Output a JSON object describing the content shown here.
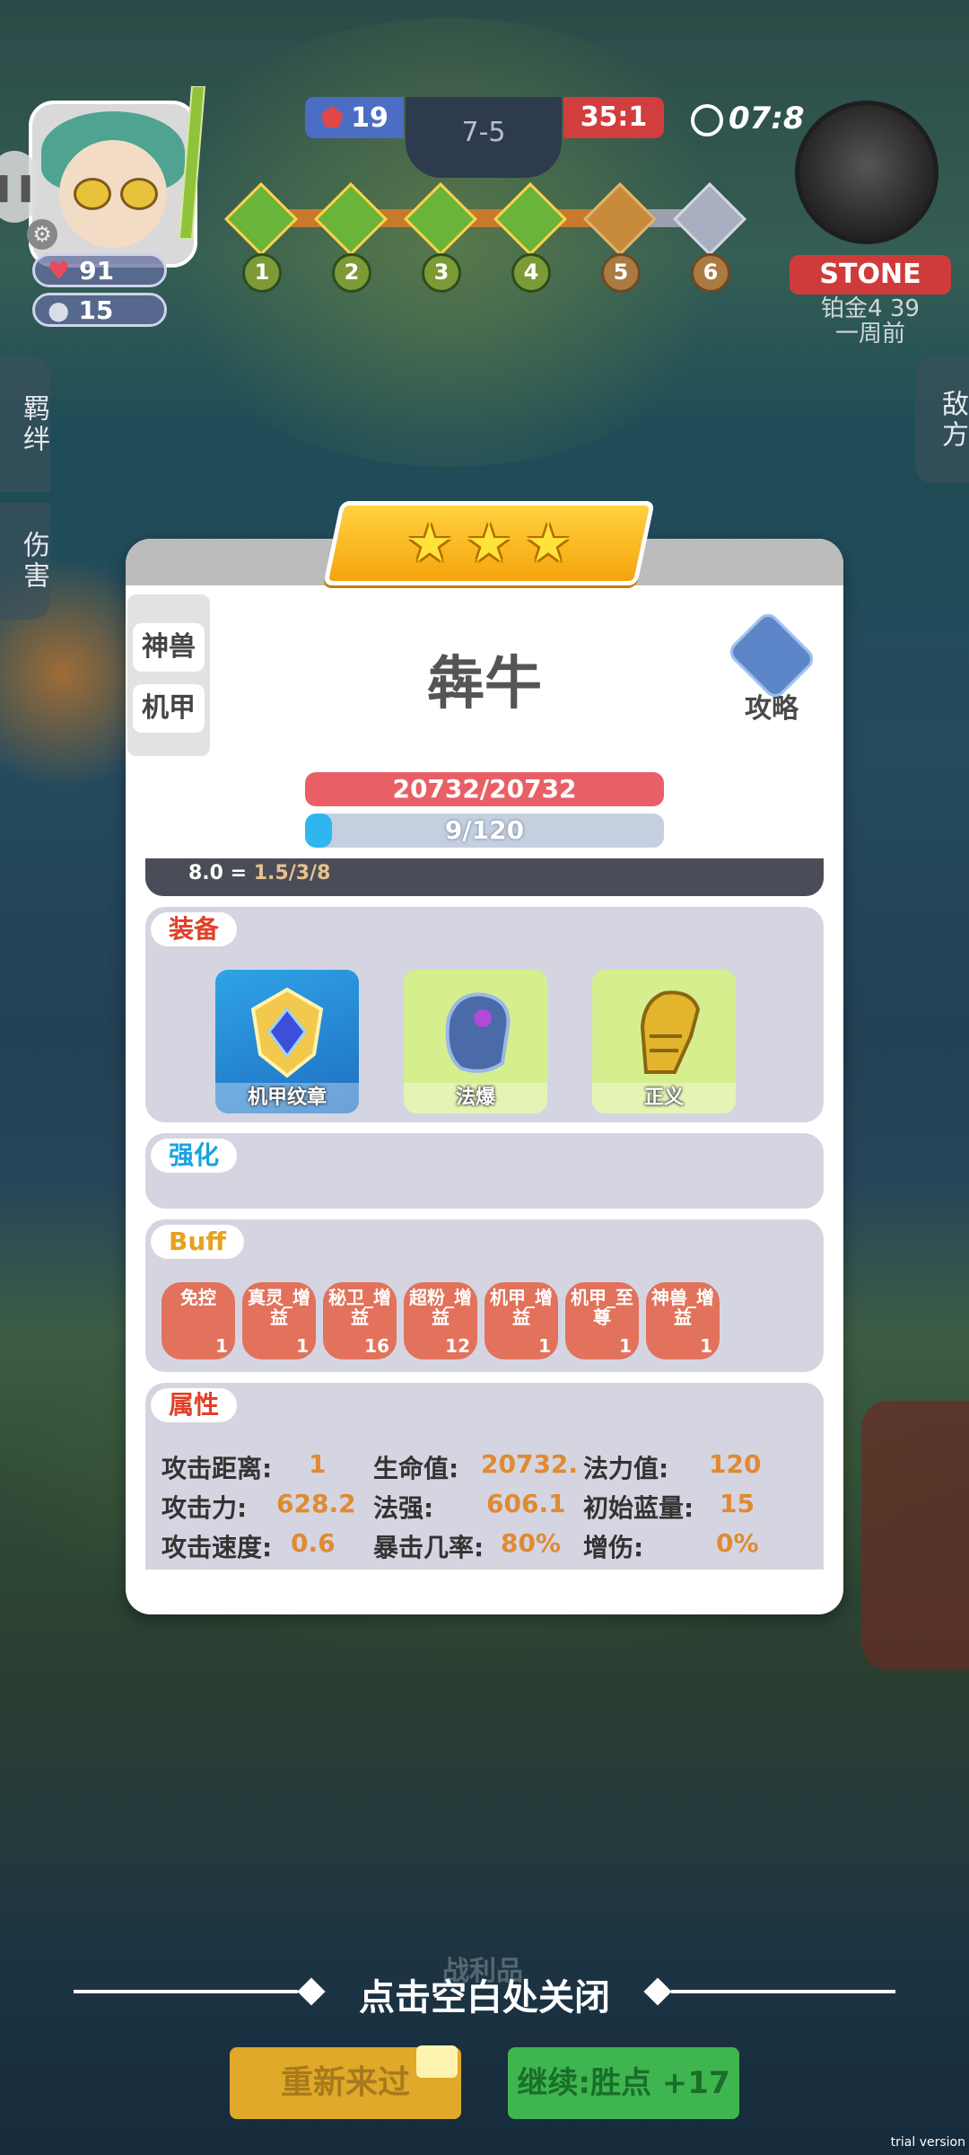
{
  "hud": {
    "player_hp": "91",
    "player_coins": "15",
    "score_left": "19",
    "round": "7-5",
    "score_right": "35:1",
    "timer": "07:8",
    "stages": [
      "1",
      "2",
      "3",
      "4",
      "5",
      "6"
    ],
    "opponent_name": "STONE",
    "opponent_rank": "铂金4 39",
    "opponent_time": "一周前",
    "side_left_1": "羁绊",
    "side_left_2": "伤害",
    "side_right": "敌方"
  },
  "card": {
    "tag1": "神兽",
    "tag2": "机甲",
    "hero_name": "犇牛",
    "guide_label": "攻略",
    "hp_text": "20732/20732",
    "mana_text": "9/120",
    "mana_fraction": 0.075,
    "formula_prefix": "8.0 = ",
    "formula_value": "1.5/3/8",
    "equip_label": "装备",
    "equipment": [
      {
        "name": "机甲纹章",
        "icon": "emblem-icon"
      },
      {
        "name": "法爆",
        "icon": "gauntlet-icon"
      },
      {
        "name": "正义",
        "icon": "golden-glove-icon"
      }
    ],
    "enhance_label": "强化",
    "buff_label": "Buff",
    "buffs": [
      {
        "name": "免控",
        "level": "1"
      },
      {
        "name": "真灵_增益",
        "level": "1"
      },
      {
        "name": "秘卫_增益",
        "level": "16"
      },
      {
        "name": "超粉_增益",
        "level": "12"
      },
      {
        "name": "机甲_增益",
        "level": "1"
      },
      {
        "name": "机甲_至尊",
        "level": "1"
      },
      {
        "name": "神兽_增益",
        "level": "1"
      }
    ],
    "attr_label": "属性",
    "attributes": {
      "range_label": "攻击距离:",
      "range": "1",
      "hp_label": "生命值:",
      "hp": "20732.",
      "mana_label": "法力值:",
      "mana": "120",
      "atk_label": "攻击力:",
      "atk": "628.2",
      "ap_label": "法强:",
      "ap": "606.1",
      "init_mana_label": "初始蓝量:",
      "init_mana": "15",
      "speed_label": "攻击速度:",
      "speed": "0.6",
      "crit_label": "暴击几率:",
      "crit": "80%",
      "dmg_label": "增伤:",
      "dmg": "0%"
    }
  },
  "footer": {
    "loot": "战利品",
    "close_hint": "点击空白处关闭",
    "retry": "重新来过",
    "continue": "继续:胜点 +17",
    "watermark": "trial version"
  },
  "colors": {
    "hp": "#e95f66",
    "mana": "#2fb6f0",
    "buff": "#e2725b",
    "value": "#e08a32"
  }
}
